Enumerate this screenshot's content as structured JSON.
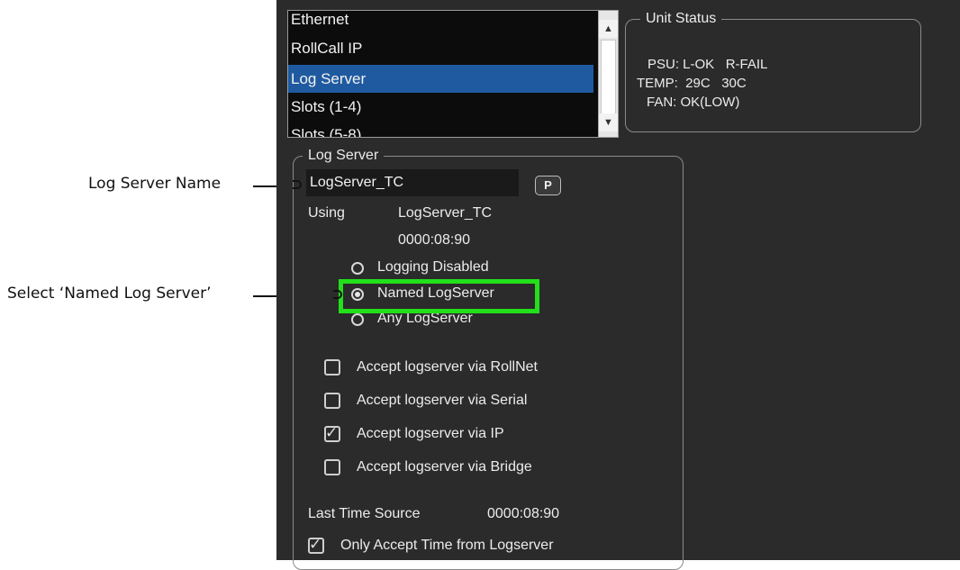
{
  "annotations": {
    "log_server_name": "Log Server Name",
    "select_named": "Select ‘Named Log Server’"
  },
  "list": {
    "items": [
      "Ethernet",
      "RollCall IP",
      "Log Server",
      "Slots (1-4)",
      "Slots (5-8)"
    ],
    "selected_index": 2
  },
  "unit_status": {
    "title": "Unit Status",
    "psu": "PSU: L-OK   R-FAIL",
    "temp": "TEMP:  29C   30C",
    "fan": "FAN: OK(LOW)"
  },
  "log_server": {
    "title": "Log Server",
    "name_value": "LogServer_TC",
    "p_button": "P",
    "using_label": "Using",
    "using_value": "LogServer_TC",
    "using_time": "0000:08:90",
    "radios": [
      {
        "label": "Logging Disabled",
        "checked": false
      },
      {
        "label": "Named LogServer",
        "checked": true
      },
      {
        "label": "Any LogServer",
        "checked": false
      }
    ],
    "checkboxes": [
      {
        "label": "Accept logserver via RollNet",
        "checked": false
      },
      {
        "label": "Accept logserver via Serial",
        "checked": false
      },
      {
        "label": "Accept logserver via IP",
        "checked": true
      },
      {
        "label": "Accept logserver via Bridge",
        "checked": false
      }
    ],
    "last_time_source_label": "Last Time Source",
    "last_time_source_value": "0000:08:90",
    "only_accept": {
      "label": "Only Accept Time from Logserver",
      "checked": true
    }
  },
  "colors": {
    "panel_bg": "#2b2b2b",
    "selection": "#1f5aa0",
    "highlight": "#22e01a"
  }
}
